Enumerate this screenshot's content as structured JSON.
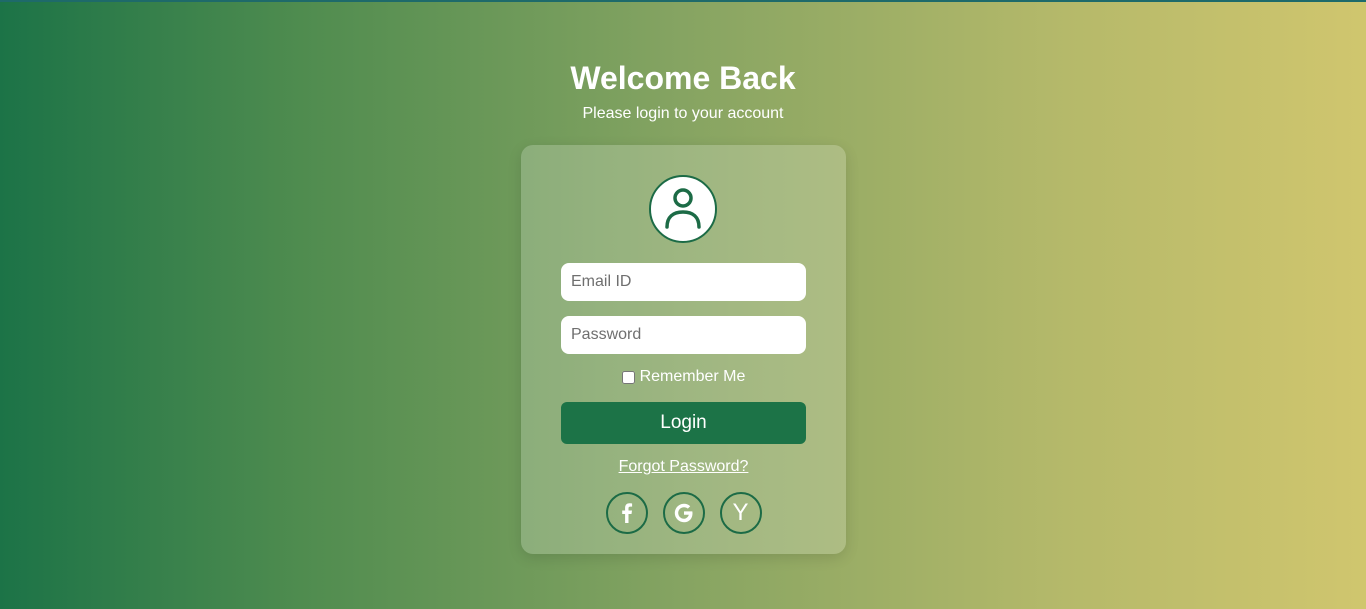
{
  "page": {
    "title": "Welcome Back",
    "subtitle": "Please login to your account"
  },
  "form": {
    "email_placeholder": "Email ID",
    "password_placeholder": "Password",
    "remember_label": "Remember Me",
    "remember_checked": false,
    "login_label": "Login",
    "forgot_label": "Forgot Password?"
  },
  "social": [
    {
      "name": "facebook-icon",
      "glyph": "f"
    },
    {
      "name": "google-icon",
      "glyph": "G"
    },
    {
      "name": "yahoo-icon",
      "glyph": "Y"
    }
  ],
  "colors": {
    "accent": "#1c7347",
    "text": "#ffffff",
    "gradient_start": "#1c7347",
    "gradient_end": "#d0c66e"
  },
  "icons": {
    "avatar": "user-icon"
  }
}
